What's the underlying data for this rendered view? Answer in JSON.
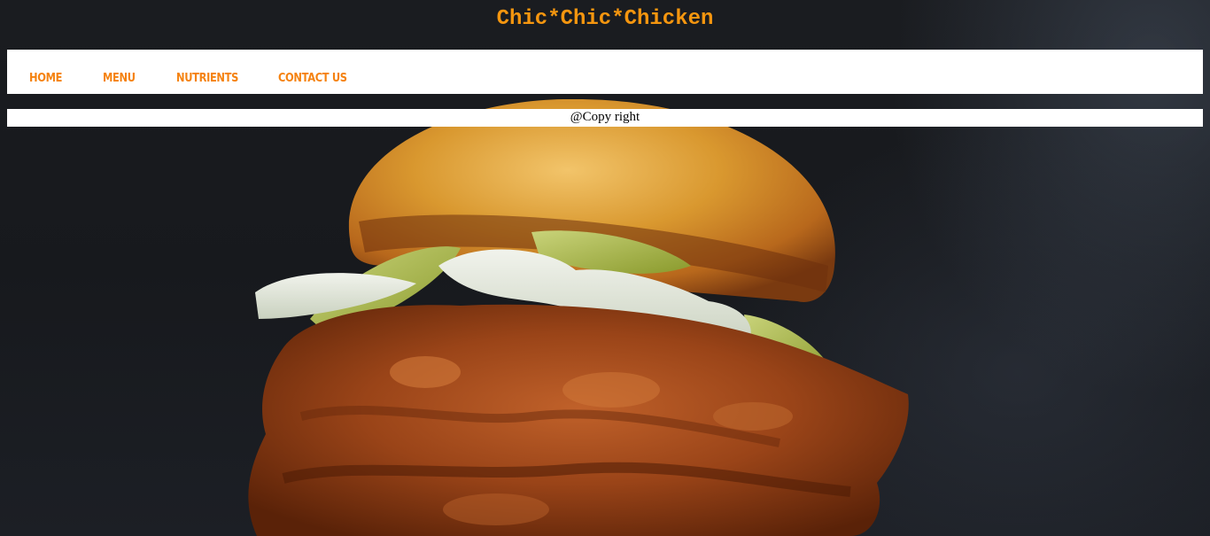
{
  "header": {
    "site_title": "Chic*Chic*Chicken"
  },
  "nav": {
    "items": [
      {
        "label": "HOME"
      },
      {
        "label": "MENU"
      },
      {
        "label": "NUTRIENTS"
      },
      {
        "label": "CONTACT US"
      }
    ]
  },
  "footer": {
    "copyright": "@Copy right"
  },
  "background": {
    "image": "fried-chicken-sandwich-photo"
  },
  "colors": {
    "title": "#f5960f",
    "nav_link": "#f5820f",
    "bar_bg": "#ffffff",
    "page_bg": "#16181c"
  }
}
